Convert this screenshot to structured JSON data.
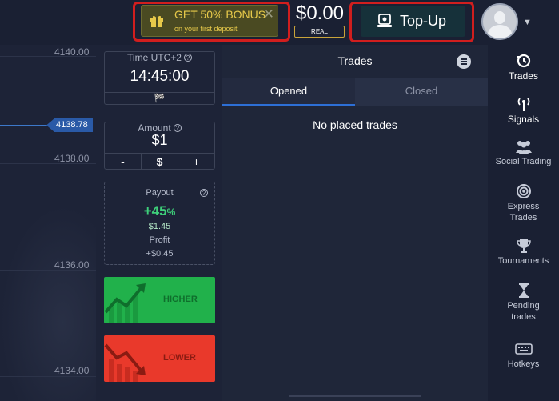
{
  "header": {
    "bonus": {
      "title": "GET 50% BONUS",
      "subtitle": "on your first deposit",
      "close": "✕"
    },
    "balance": {
      "amount": "$0.00",
      "account_type": "REAL"
    },
    "topup_label": "Top-Up"
  },
  "chart": {
    "prices": [
      "4140.00",
      "4138.00",
      "4136.00",
      "4134.00"
    ],
    "current_price": "4138.78"
  },
  "deal": {
    "time": {
      "caption": "Time UTC+2",
      "value": "14:45:00",
      "flag": "🏁"
    },
    "amount": {
      "caption": "Amount",
      "value": "$1",
      "minus": "-",
      "currency": "$",
      "plus": "+"
    },
    "payout": {
      "caption": "Payout",
      "percent": "+45",
      "percent_sign": "%",
      "amount": "$1.45",
      "profit_label": "Profit",
      "profit_value": "+$0.45"
    },
    "higher_label": "HIGHER",
    "lower_label": "LOWER",
    "help_glyph": "?"
  },
  "trades": {
    "title": "Trades",
    "tabs": [
      "Opened",
      "Closed"
    ],
    "empty_message": "No placed trades"
  },
  "sidebar": {
    "items": [
      {
        "label": "Trades",
        "icon": "trades-history-icon"
      },
      {
        "label": "Signals",
        "icon": "signal-antenna-icon"
      },
      {
        "label": "Social Trading",
        "icon": "people-icon"
      },
      {
        "label": "Express\nTrades",
        "icon": "target-icon"
      },
      {
        "label": "Tournaments",
        "icon": "trophy-icon"
      },
      {
        "label": "Pending\ntrades",
        "icon": "hourglass-icon"
      },
      {
        "label": "Hotkeys",
        "icon": "keyboard-icon"
      }
    ]
  },
  "colors": {
    "accent_red_outline": "#d11e1e",
    "bonus_yellow": "#e7c94a",
    "higher_green": "#21b14b",
    "lower_red": "#e9392b",
    "payout_green": "#3ed07a",
    "tab_underline": "#2d6fd6"
  }
}
